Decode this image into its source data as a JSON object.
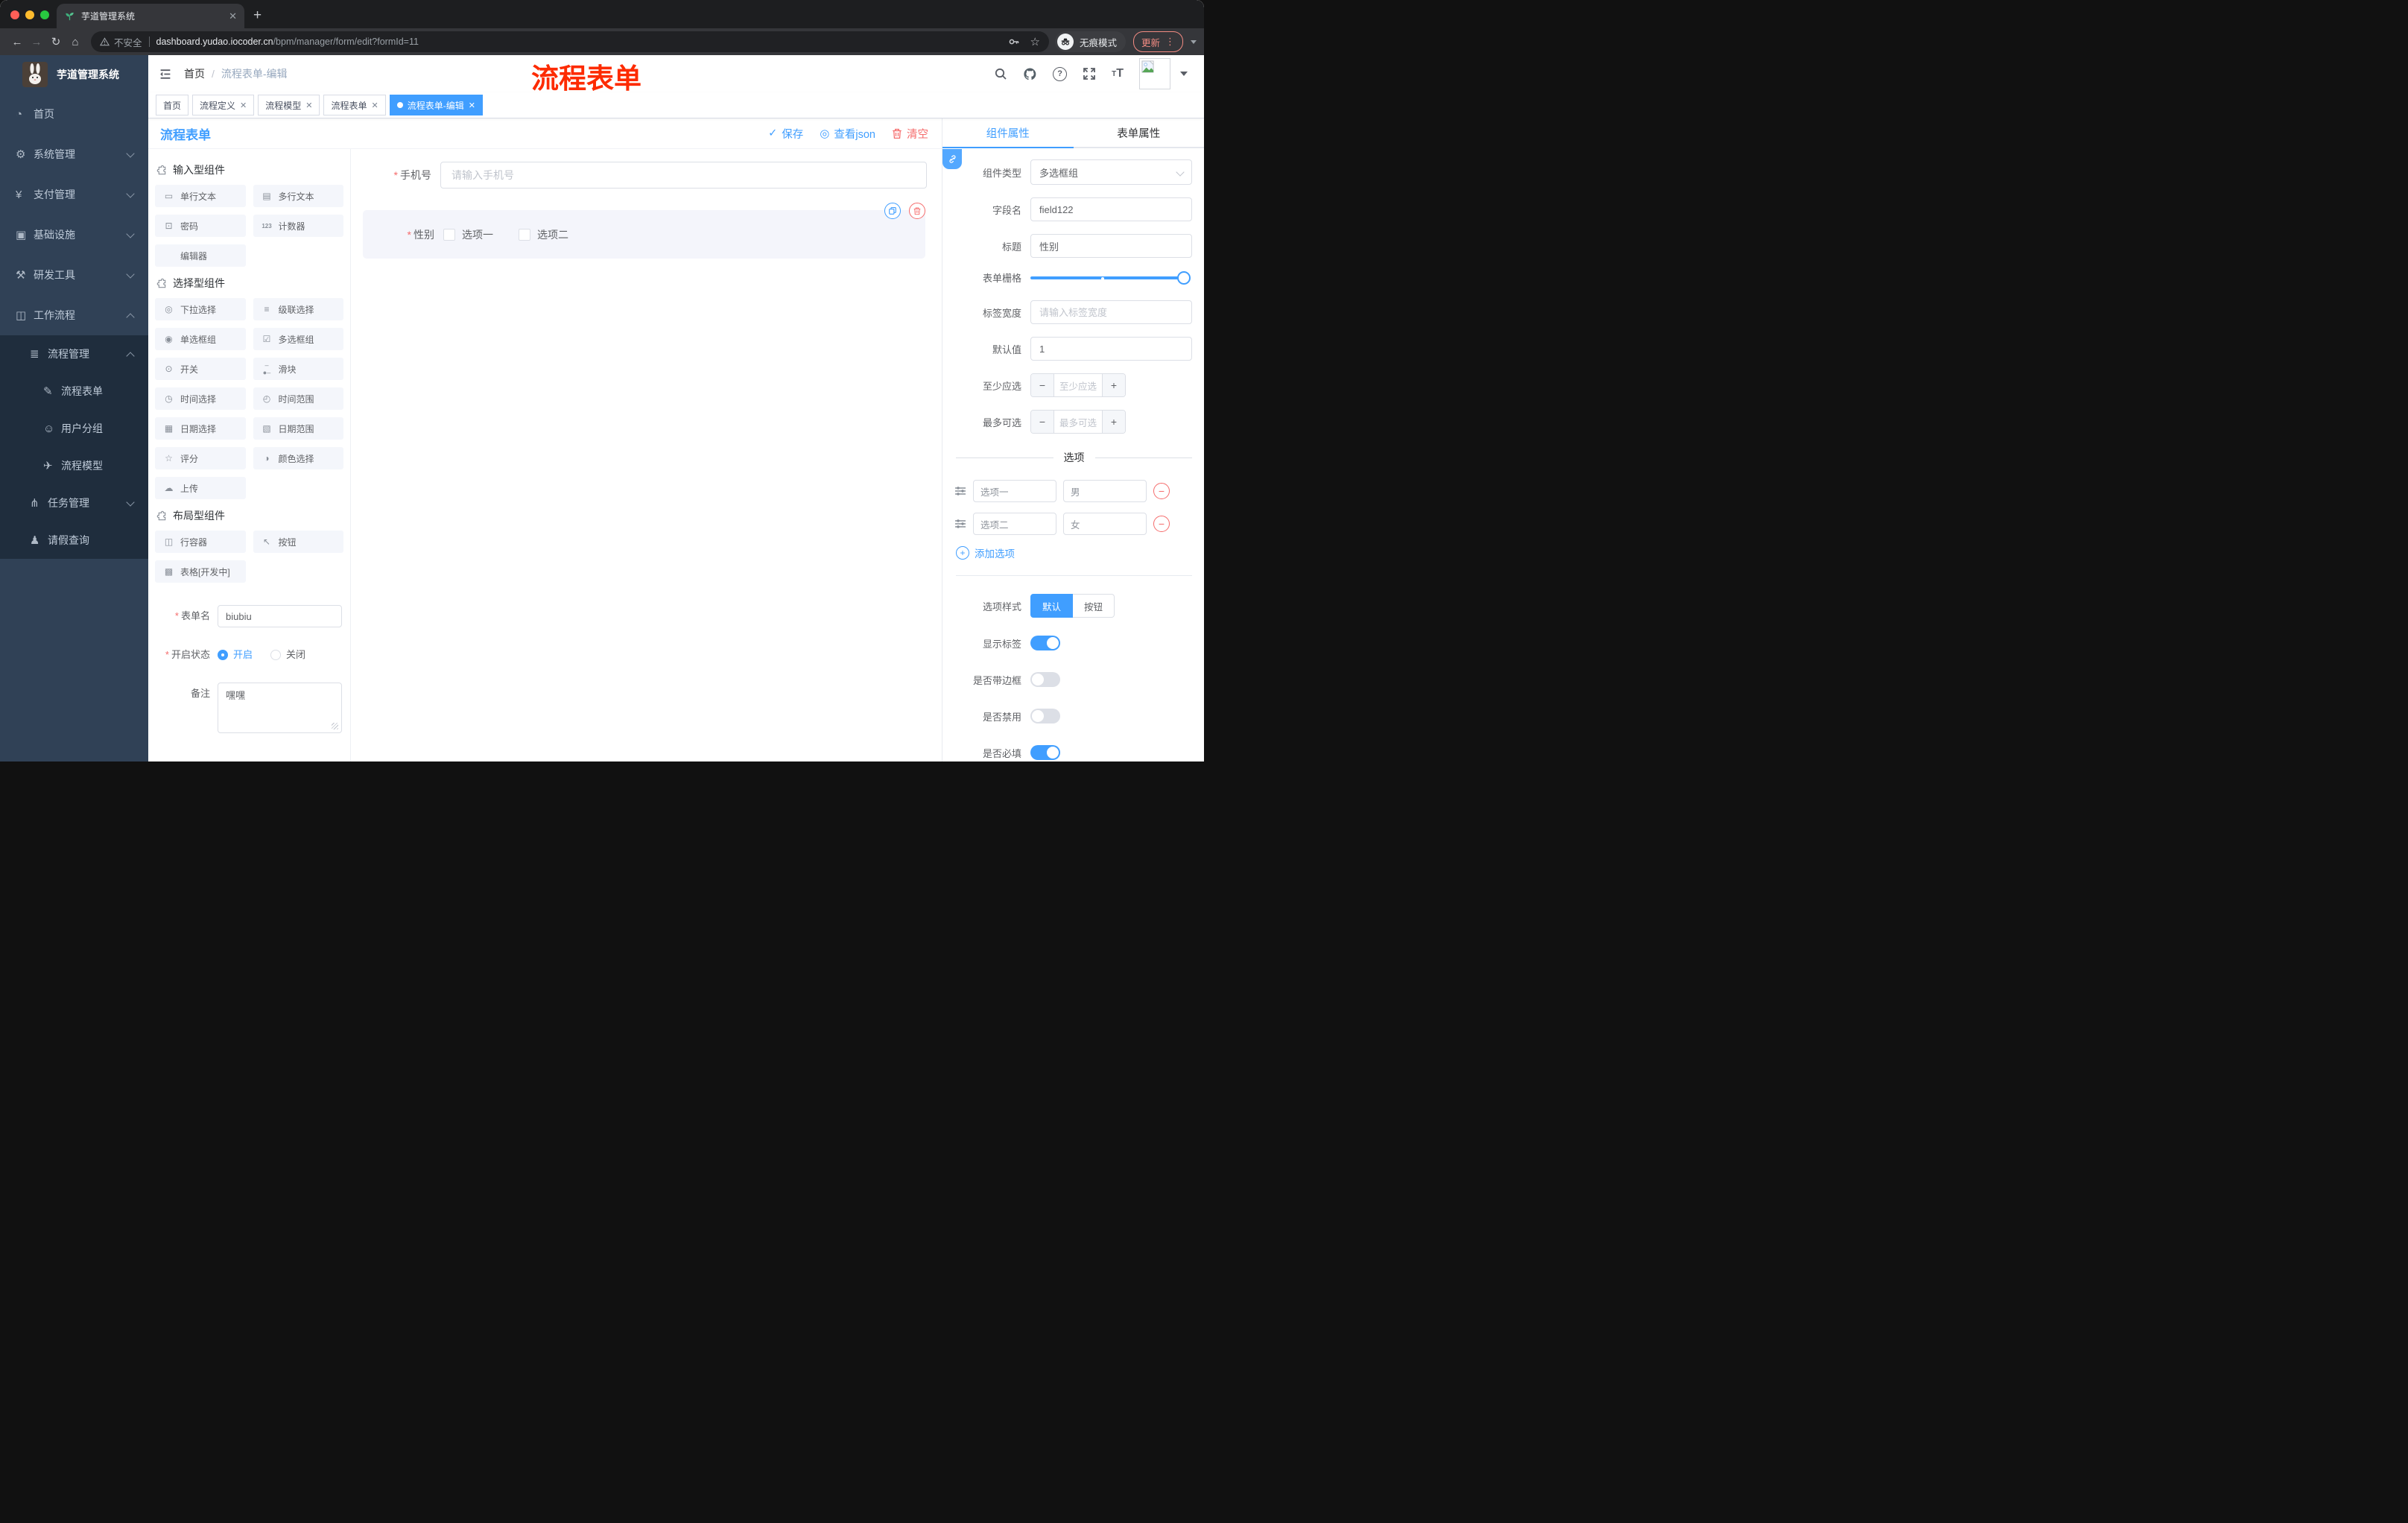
{
  "browser": {
    "tab_title": "芋道管理系统",
    "security_label": "不安全",
    "url_host": "dashboard.yudao.iocoder.cn",
    "url_path": "/bpm/manager/form/edit?formId=11",
    "incognito_label": "无痕模式",
    "update_label": "更新"
  },
  "sidebar": {
    "title": "芋道管理系统",
    "items": [
      "首页",
      "系统管理",
      "支付管理",
      "基础设施",
      "研发工具",
      "工作流程",
      "流程管理",
      "流程表单",
      "用户分组",
      "流程模型",
      "任务管理",
      "请假查询"
    ]
  },
  "header": {
    "breadcrumb_home": "首页",
    "breadcrumb_current": "流程表单-编辑",
    "annotation": "流程表单"
  },
  "tags": [
    "首页",
    "流程定义",
    "流程模型",
    "流程表单",
    "流程表单-编辑"
  ],
  "toolbar": {
    "title": "流程表单",
    "save": "保存",
    "view_json": "查看json",
    "clear": "清空"
  },
  "panel": {
    "section_input": "输入型组件",
    "section_select": "选择型组件",
    "section_layout": "布局型组件",
    "input_items": [
      "单行文本",
      "多行文本",
      "密码",
      "计数器",
      "编辑器"
    ],
    "select_items": [
      "下拉选择",
      "级联选择",
      "单选框组",
      "多选框组",
      "开关",
      "滑块",
      "时间选择",
      "时间范围",
      "日期选择",
      "日期范围",
      "评分",
      "颜色选择",
      "上传"
    ],
    "layout_items": [
      "行容器",
      "按钮",
      "表格[开发中]"
    ],
    "form_name_label": "表单名",
    "form_name_value": "biubiu",
    "form_status_label": "开启状态",
    "status_on": "开启",
    "status_off": "关闭",
    "form_remark_label": "备注",
    "form_remark_value": "嘿嘿"
  },
  "canvas": {
    "phone_label": "手机号",
    "phone_placeholder": "请输入手机号",
    "gender_label": "性别",
    "gender_opt1": "选项一",
    "gender_opt2": "选项二"
  },
  "props": {
    "tab_component": "组件属性",
    "tab_form": "表单属性",
    "type_label": "组件类型",
    "type_value": "多选框组",
    "field_label": "字段名",
    "field_value": "field122",
    "title_label": "标题",
    "title_value": "性别",
    "grid_label": "表单栅格",
    "width_label": "标签宽度",
    "width_placeholder": "请输入标签宽度",
    "default_label": "默认值",
    "default_value": "1",
    "min_label": "至少应选",
    "min_placeholder": "至少应选",
    "max_label": "最多可选",
    "max_placeholder": "最多可选",
    "options_title": "选项",
    "options": [
      {
        "label": "选项一",
        "value": "男"
      },
      {
        "label": "选项二",
        "value": "女"
      }
    ],
    "add_option": "添加选项",
    "style_label": "选项样式",
    "style_default": "默认",
    "style_button": "按钮",
    "show_label_label": "显示标签",
    "border_label": "是否带边框",
    "disabled_label": "是否禁用",
    "required_label": "是否必填"
  },
  "colors": {
    "accent": "#409eff",
    "danger": "#f56c6c",
    "annotation_red": "#fd2b01",
    "sidebar_bg": "#304156",
    "sidebar_sub_bg": "#1f2d3d"
  }
}
